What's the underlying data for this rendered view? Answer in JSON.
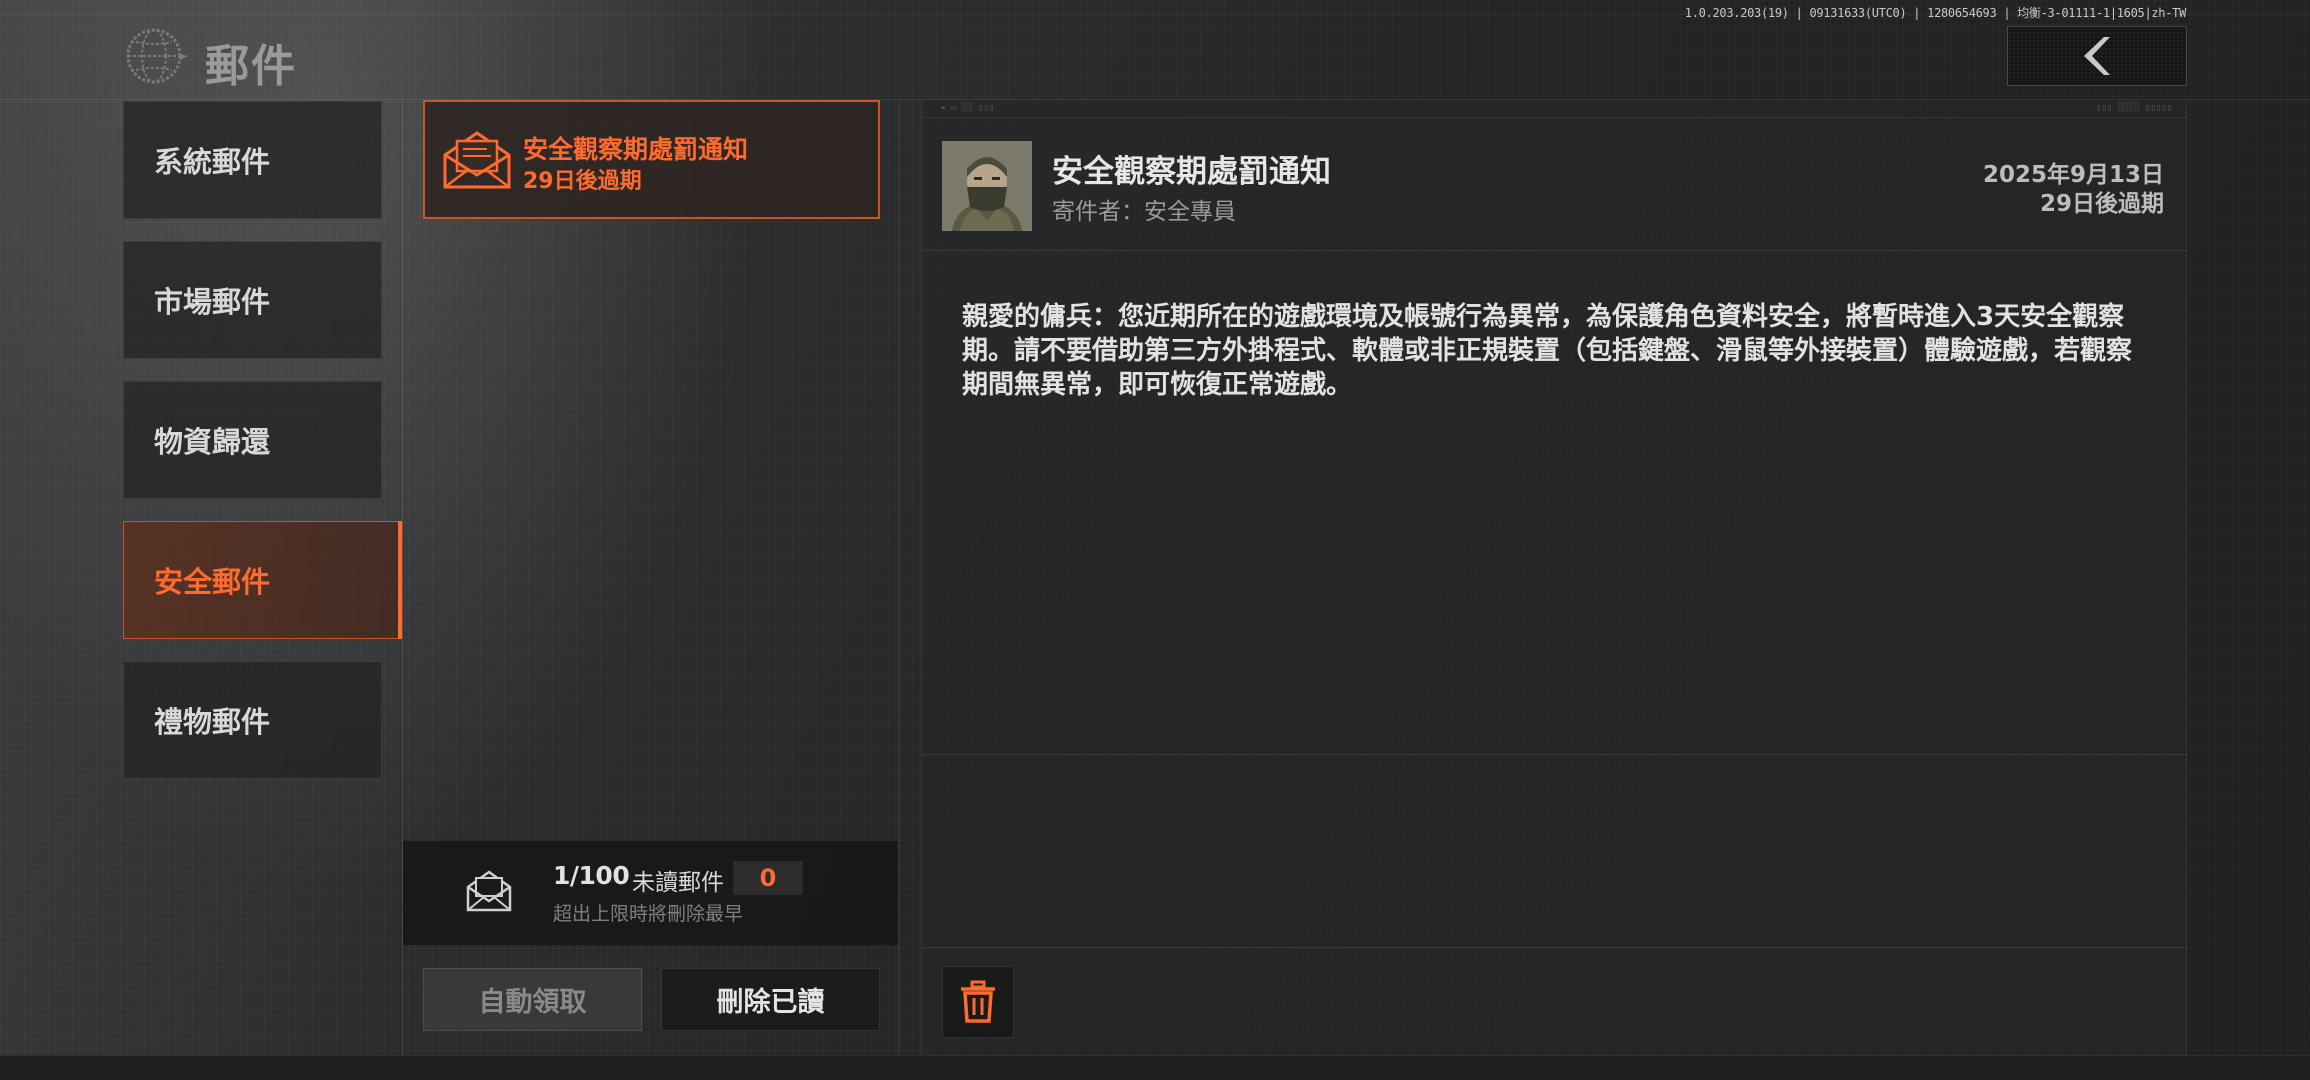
{
  "app": {
    "title": "郵件",
    "version_info": "1.0.203.203(19) | 09131633(UTC0) | 1280654693 | 均衡-3-01111-1|1605|zh-TW"
  },
  "sidebar": {
    "items": [
      {
        "label": "系統郵件",
        "active": false
      },
      {
        "label": "市場郵件",
        "active": false
      },
      {
        "label": "物資歸還",
        "active": false
      },
      {
        "label": "安全郵件",
        "active": true
      },
      {
        "label": "禮物郵件",
        "active": false
      }
    ]
  },
  "mail_list": {
    "items": [
      {
        "title": "安全觀察期處罰通知",
        "expiry": "29日後過期",
        "selected": true
      }
    ],
    "count": "1/100",
    "unread_label": "未讀郵件",
    "unread_count": "0",
    "limit_note": "超出上限時將刪除最早",
    "auto_claim_label": "自動領取",
    "delete_read_label": "刪除已讀"
  },
  "detail": {
    "title": "安全觀察期處罰通知",
    "sender": "寄件者：安全專員",
    "date": "2025年9月13日",
    "expiry": "29日後過期",
    "body": "親愛的傭兵：您近期所在的遊戲環境及帳號行為異常，為保護角色資料安全，將暫時進入3天安全觀察期。請不要借助第三方外掛程式、軟體或非正規裝置（包括鍵盤、滑鼠等外接裝置）體驗遊戲，若觀察期間無異常，即可恢復正常遊戲。"
  },
  "icons": {
    "back": "chevron-left-icon",
    "globe": "globe-icon",
    "mail": "envelope-icon",
    "stats": "envelope-open-icon",
    "trash": "trash-icon"
  },
  "colors": {
    "accent": "#ff6a2e",
    "accent_border": "#c9562a",
    "background": "#222324",
    "panel": "#262728",
    "text": "#e2e2e2",
    "muted_text": "#9a9a9a"
  }
}
